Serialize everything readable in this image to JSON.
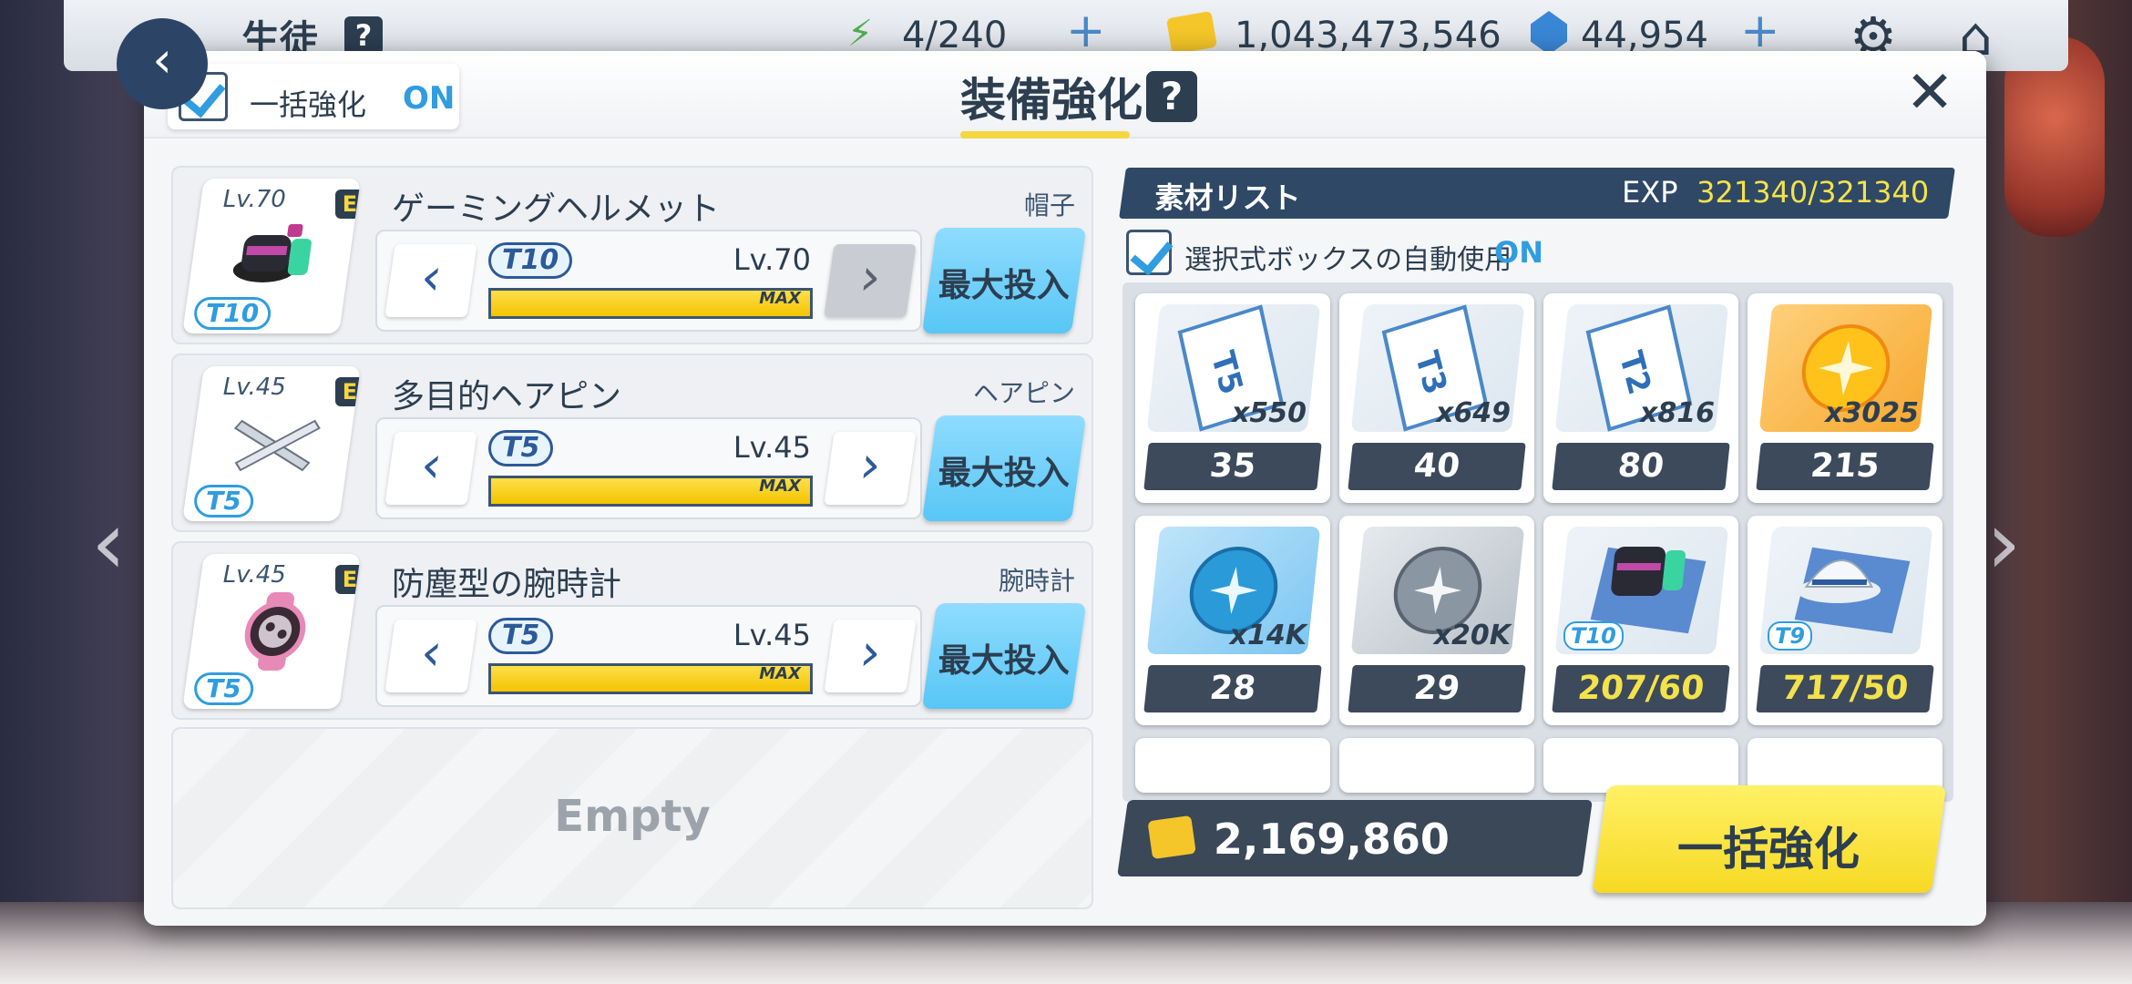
{
  "topbar": {
    "title": "生徒",
    "help": "?",
    "ap": "4/240",
    "credits": "1,043,473,546",
    "gems": "44,954"
  },
  "modal": {
    "bulk_toggle_label": "一括強化",
    "bulk_toggle_state": "ON",
    "title": "装備強化",
    "help": "?",
    "close": "✕"
  },
  "equipment": [
    {
      "name": "ゲーミングヘルメット",
      "category": "帽子",
      "icon_lv": "Lv.70",
      "tier": "T10",
      "level": "Lv.70",
      "max_label": "MAX",
      "progress": 1.0,
      "button": "最大投入",
      "grade": "E"
    },
    {
      "name": "多目的ヘアピン",
      "category": "ヘアピン",
      "icon_lv": "Lv.45",
      "tier": "T5",
      "level": "Lv.45",
      "max_label": "MAX",
      "progress": 1.0,
      "button": "最大投入",
      "grade": "E"
    },
    {
      "name": "防塵型の腕時計",
      "category": "腕時計",
      "icon_lv": "Lv.45",
      "tier": "T5",
      "level": "Lv.45",
      "max_label": "MAX",
      "progress": 1.0,
      "button": "最大投入",
      "grade": "E"
    }
  ],
  "empty_slot": "Empty",
  "materials": {
    "title": "素材リスト",
    "exp_label": "EXP",
    "exp_value": "321340/321340",
    "auto_label": "選択式ボックスの自動使用",
    "auto_state": "ON",
    "items": [
      {
        "kind": "blueprint",
        "tier_mark": "T5",
        "qty": "x550",
        "count": "35",
        "highlight": false
      },
      {
        "kind": "blueprint",
        "tier_mark": "T3",
        "qty": "x649",
        "count": "40",
        "highlight": false
      },
      {
        "kind": "blueprint",
        "tier_mark": "T2",
        "qty": "x816",
        "count": "80",
        "highlight": false
      },
      {
        "kind": "orb-gold",
        "tier_mark": "",
        "qty": "x3025",
        "count": "215",
        "highlight": false
      },
      {
        "kind": "orb-blue",
        "tier_mark": "",
        "qty": "x14K",
        "count": "28",
        "highlight": false
      },
      {
        "kind": "orb-silver",
        "tier_mark": "",
        "qty": "x20K",
        "count": "29",
        "highlight": false
      },
      {
        "kind": "equip-helmet",
        "tier_mark": "T10",
        "qty": "",
        "count": "207/60",
        "highlight": true
      },
      {
        "kind": "equip-cap",
        "tier_mark": "T9",
        "qty": "",
        "count": "717/50",
        "highlight": true
      }
    ]
  },
  "cost": "2,169,860",
  "bulk_button": "一括強化",
  "colors": {
    "accent_blue": "#2f9de0",
    "navy": "#2c3e50",
    "gold": "#f4e24a",
    "max_btn": "#58c6f6",
    "bulk_btn": "#f6d923"
  }
}
